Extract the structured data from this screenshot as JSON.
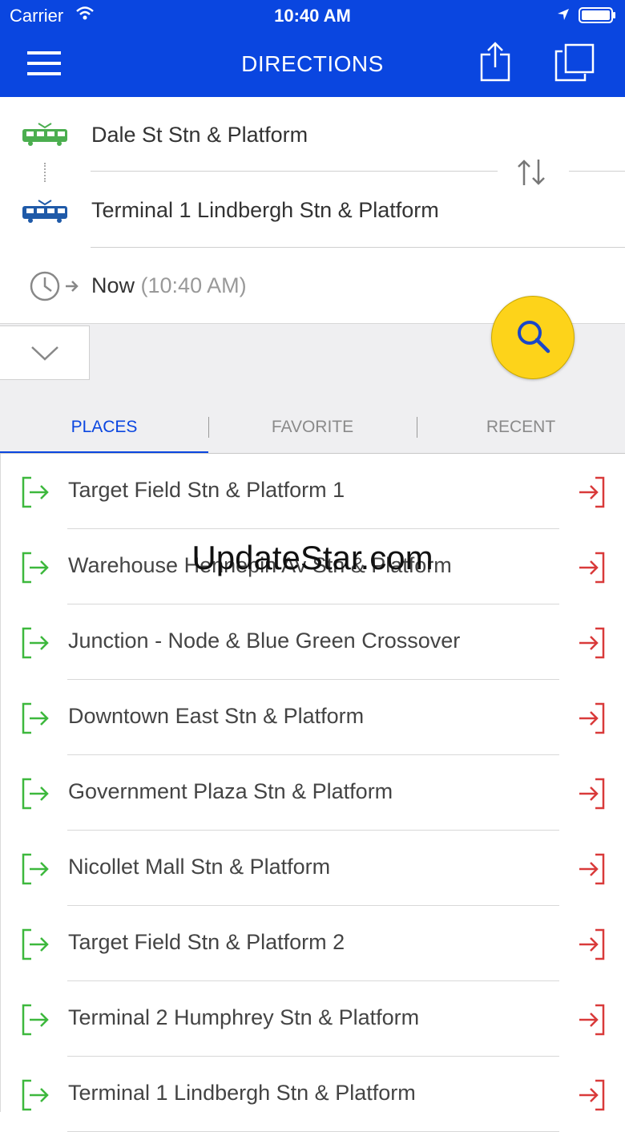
{
  "status_bar": {
    "carrier": "Carrier",
    "time": "10:40 AM"
  },
  "nav": {
    "title": "DIRECTIONS"
  },
  "trip": {
    "origin": "Dale St Stn & Platform",
    "destination": "Terminal 1 Lindbergh Stn & Platform",
    "time_label": "Now",
    "time_value": "(10:40 AM)"
  },
  "tabs": [
    {
      "label": "PLACES",
      "active": true
    },
    {
      "label": "FAVORITE",
      "active": false
    },
    {
      "label": "RECENT",
      "active": false
    }
  ],
  "places": [
    "Target Field Stn & Platform 1",
    "Warehouse Hennepin Av Stn & Platform",
    "Junction - Node & Blue Green Crossover",
    "Downtown East Stn & Platform",
    "Government Plaza Stn & Platform",
    "Nicollet Mall Stn & Platform",
    "Target Field Stn & Platform 2",
    "Terminal 2 Humphrey Stn & Platform",
    "Terminal 1 Lindbergh Stn & Platform"
  ],
  "watermark": "UpdateStar.com",
  "colors": {
    "brand_blue": "#0A46E0",
    "search_yellow": "#FDD31A",
    "from_green": "#3DB83D",
    "to_red": "#D93A3A",
    "origin_tram_green": "#4BAE4F",
    "dest_tram_blue": "#1F5AA8"
  }
}
